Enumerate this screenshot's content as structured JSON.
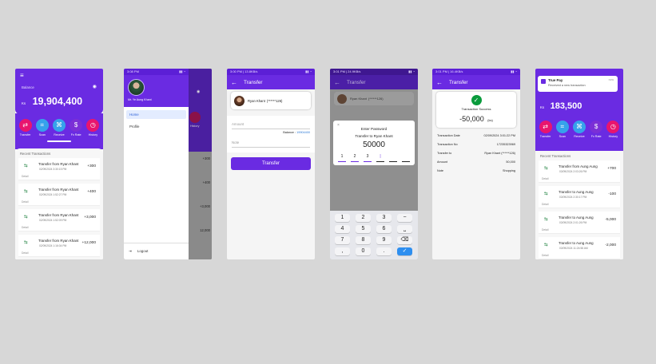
{
  "colors": {
    "primary": "#6a2be2",
    "background": "#d7d7d7"
  },
  "home": {
    "status": "",
    "balance_label": "Balance",
    "currency": "Ks",
    "balance": "19,904,400",
    "actions": [
      {
        "label": "Transfer",
        "icon": "transfer-icon",
        "color": "#e8156e"
      },
      {
        "label": "Scan",
        "icon": "scan-icon",
        "color": "#36a2eb"
      },
      {
        "label": "Receive",
        "icon": "receive-icon",
        "color": "#36a2eb"
      },
      {
        "label": "Fx Rate",
        "icon": "dollar-icon",
        "color": "#7b2fd6"
      },
      {
        "label": "History",
        "icon": "clock-icon",
        "color": "#e8156e"
      }
    ],
    "recent_title": "Recent Transactions",
    "transactions": [
      {
        "title": "Transfer from Ryan Khant",
        "date": "02/09/2024 3:30:15 PM",
        "amount": "+300",
        "detail": "Detail"
      },
      {
        "title": "Transfer from Ryan Khant",
        "date": "02/09/2024 1:52:27 PM",
        "amount": "+400",
        "detail": "Detail"
      },
      {
        "title": "Transfer from Ryan Khant",
        "date": "02/09/2024 1:52:09 PM",
        "amount": "+3,000",
        "detail": "Detail"
      },
      {
        "title": "Transfer from Ryan Khant",
        "date": "02/09/2024 1:16:04 PM",
        "amount": "+12,000",
        "detail": "Detail"
      }
    ]
  },
  "drawer": {
    "status_time": "3:08 PM",
    "user_name": "Mr. Ye Aung Khant",
    "items": [
      "Home",
      "Profile"
    ],
    "logout": "Logout",
    "behind_amounts": [
      "+300",
      "+400",
      "+3,000",
      "12,000"
    ],
    "behind_history": "History"
  },
  "transfer": {
    "status_time": "3:00 PM | 13.8KB/s",
    "title": "Transfer",
    "recipient": "Ryan Khant",
    "recipient_phone": "(******126)",
    "amount_placeholder": "Amount",
    "balance_label": "Balance :",
    "balance_value": "19904400",
    "note_placeholder": "Note",
    "button": "Transfer"
  },
  "password": {
    "status_time": "3:01 PM | 24.9KB/s",
    "title": "Transfer",
    "recipient": "Ryan Khant",
    "recipient_phone": "(******126)",
    "dialog_title": "Enter Password",
    "dialog_subtitle": "Transfer to Ryan Khant",
    "amount": "50000",
    "entered": [
      "1",
      "2",
      "3"
    ],
    "keys": [
      "1",
      "2",
      "3",
      "−",
      "4",
      "5",
      "6",
      "⎵",
      "7",
      "8",
      "9",
      "⌫",
      ",",
      "0",
      ".",
      "✓"
    ]
  },
  "success": {
    "status_time": "3:01 PM | 16.4KB/s",
    "title": "Transfer",
    "message": "Transaction Success",
    "amount": "-50,000",
    "currency": "(ks)",
    "rows": [
      {
        "label": "Transaction Date",
        "value": "02/09/2024 3:01:22 PM"
      },
      {
        "label": "Transaction No",
        "value": "17235323969"
      },
      {
        "label": "Transfer to",
        "value": "Ryan Khant (******126)"
      },
      {
        "label": "Amount",
        "value": "50,000"
      },
      {
        "label": "Note",
        "value": "Shopping"
      }
    ]
  },
  "notif": {
    "app": "True Pay",
    "time": "now",
    "message": "Received a new transaction",
    "currency": "Ks",
    "balance": "183,500",
    "recent_title": "Recent Transactions",
    "transactions": [
      {
        "title": "Transfer from Aung Aung",
        "date": "03/09/2024 2:03:26 PM",
        "amount": "+700",
        "detail": "Detail"
      },
      {
        "title": "Transfer to Aung Aung",
        "date": "03/09/2024 2:30:17 PM",
        "amount": "-100",
        "detail": "Detail"
      },
      {
        "title": "Transfer to Aung Aung",
        "date": "03/09/2024 2:01:26 PM",
        "amount": "-5,000",
        "detail": "Detail"
      },
      {
        "title": "Transfer to Aung Aung",
        "date": "03/09/2024 11:24:58 AM",
        "amount": "-2,000",
        "detail": "Detail"
      }
    ]
  }
}
